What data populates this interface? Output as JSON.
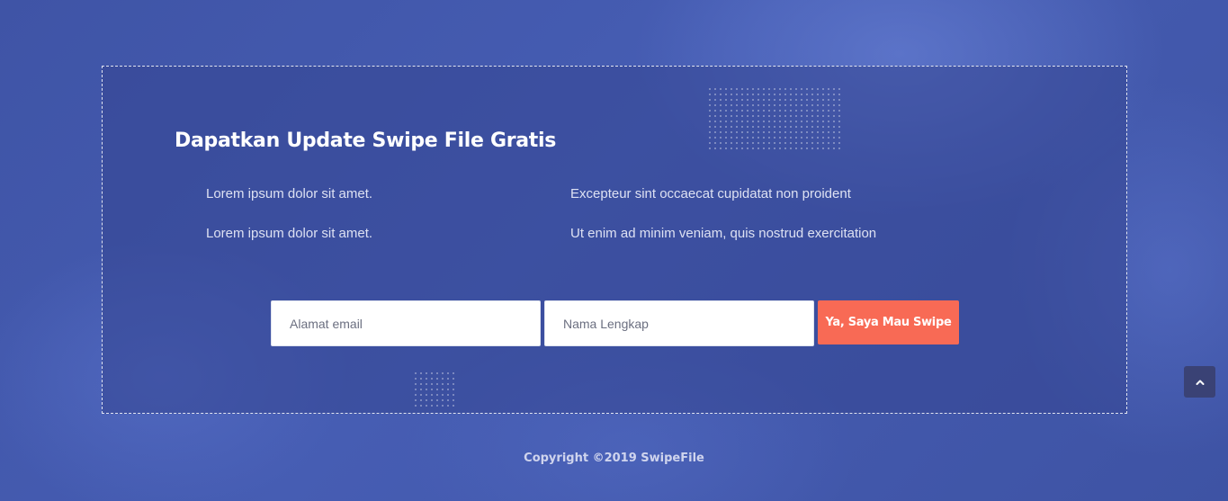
{
  "section": {
    "heading": "Dapatkan Update Swipe File Gratis",
    "features_left": [
      "Lorem ipsum dolor sit amet.",
      "Lorem ipsum dolor sit amet."
    ],
    "features_right": [
      "Excepteur sint occaecat cupidatat non proident",
      "Ut enim ad minim veniam, quis nostrud exercitation"
    ]
  },
  "form": {
    "email_placeholder": "Alamat email",
    "email_value": "",
    "name_placeholder": "Nama Lengkap",
    "name_value": "",
    "submit_label": "Ya, Saya Mau Swipe"
  },
  "footer": {
    "copyright": "Copyright ©2019 SwipeFile"
  },
  "scroll_top": {
    "icon": "chevron-up-icon"
  },
  "colors": {
    "background": "#4055a8",
    "accent": "#f86a55",
    "scroll_button": "#3a4275"
  }
}
